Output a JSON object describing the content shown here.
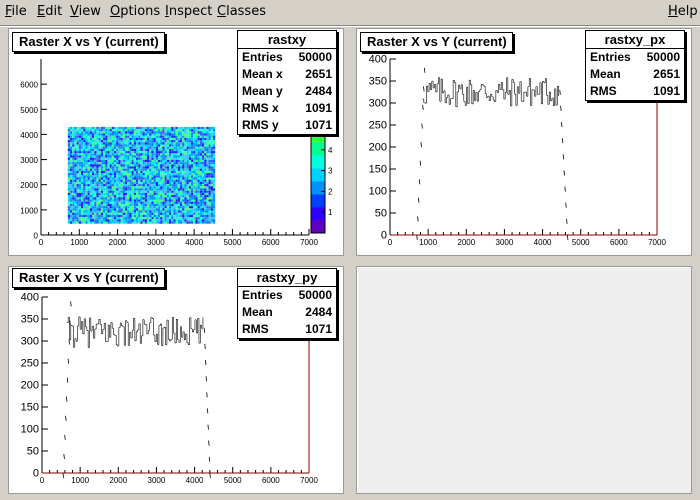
{
  "menubar": {
    "items": [
      {
        "label": "File",
        "ul": "F",
        "rest": "ile"
      },
      {
        "label": "Edit",
        "ul": "E",
        "rest": "dit"
      },
      {
        "label": "View",
        "ul": "V",
        "rest": "iew"
      },
      {
        "label": "Options",
        "ul": "O",
        "rest": "ptions"
      },
      {
        "label": "Inspect",
        "ul": "I",
        "rest": "nspect"
      },
      {
        "label": "Classes",
        "ul": "C",
        "rest": "lasses"
      }
    ],
    "help": {
      "label": "Help",
      "ul": "H",
      "rest": "elp"
    }
  },
  "pads": {
    "top_left": {
      "title": "Raster X vs Y (current)",
      "stats": {
        "name": "rastxy",
        "rows": [
          {
            "k": "Entries",
            "v": "50000"
          },
          {
            "k": "Mean x",
            "v": "2651"
          },
          {
            "k": "Mean y",
            "v": "2484"
          },
          {
            "k": "RMS x",
            "v": "1091"
          },
          {
            "k": "RMS y",
            "v": "1071"
          }
        ]
      }
    },
    "top_right": {
      "title": "Raster X vs Y (current)",
      "stats": {
        "name": "rastxy_px",
        "rows": [
          {
            "k": "Entries",
            "v": "50000"
          },
          {
            "k": "Mean",
            "v": "2651"
          },
          {
            "k": "RMS",
            "v": "1091"
          }
        ]
      }
    },
    "bottom_left": {
      "title": "Raster X vs Y (current)",
      "stats": {
        "name": "rastxy_py",
        "rows": [
          {
            "k": "Entries",
            "v": "50000"
          },
          {
            "k": "Mean",
            "v": "2484"
          },
          {
            "k": "RMS",
            "v": "1071"
          }
        ]
      }
    }
  },
  "chart_data": [
    {
      "type": "heatmap",
      "x_range": [
        0,
        7000
      ],
      "y_range": [
        0,
        7000
      ],
      "xticks": [
        "0",
        "1000",
        "2000",
        "3000",
        "4000",
        "5000",
        "6000",
        "7000"
      ],
      "yticks": [
        "0",
        "1000",
        "2000",
        "3000",
        "4000",
        "5000",
        "6000"
      ],
      "filled_region": {
        "x": [
          700,
          4500
        ],
        "y": [
          500,
          4300
        ]
      },
      "colorbar_ticks": [
        "1",
        "2",
        "3",
        "4"
      ],
      "colorbar_range": [
        0,
        5
      ],
      "colors": {
        "low": "#3030ff",
        "high": "#30ff60"
      }
    },
    {
      "type": "bar",
      "x_range": [
        0,
        7000
      ],
      "ylim": [
        0,
        400
      ],
      "xticks": [
        "0",
        "1000",
        "2000",
        "3000",
        "4000",
        "5000",
        "6000",
        "7000"
      ],
      "yticks": [
        "0",
        "50",
        "100",
        "150",
        "200",
        "250",
        "300",
        "350",
        "400"
      ],
      "plateau": {
        "x_start": 850,
        "x_end": 4450,
        "level": 325,
        "spread": 35
      },
      "rising_edge": [
        [
          700,
          0
        ],
        [
          900,
          380
        ]
      ],
      "falling_edge": [
        [
          4450,
          330
        ],
        [
          4650,
          0
        ]
      ],
      "peak_max": 400
    },
    {
      "type": "bar",
      "x_range": [
        0,
        7000
      ],
      "ylim": [
        0,
        400
      ],
      "xticks": [
        "0",
        "1000",
        "2000",
        "3000",
        "4000",
        "5000",
        "6000",
        "7000"
      ],
      "yticks": [
        "0",
        "50",
        "100",
        "150",
        "200",
        "250",
        "300",
        "350",
        "400"
      ],
      "plateau": {
        "x_start": 650,
        "x_end": 4250,
        "level": 320,
        "spread": 35
      },
      "rising_edge": [
        [
          550,
          0
        ],
        [
          750,
          390
        ]
      ],
      "falling_edge": [
        [
          4250,
          330
        ],
        [
          4400,
          0
        ]
      ],
      "peak_max": 400
    }
  ]
}
